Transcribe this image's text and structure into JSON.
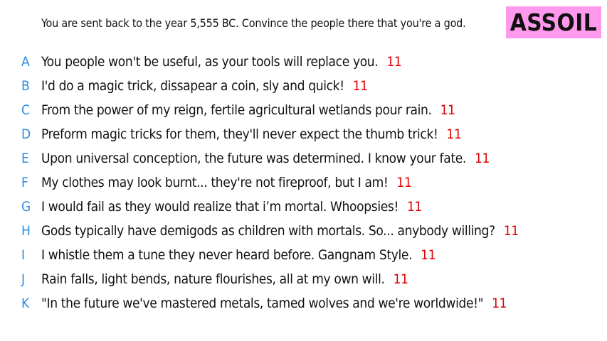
{
  "prompt": "You are sent back to the year 5,555 BC. Convince the people there that you're a god.",
  "player": {
    "name": "ASSOIL",
    "badge_color": "#ff99ee"
  },
  "colors": {
    "letter": "#2d8ce0",
    "score": "#e00000",
    "text": "#111111"
  },
  "answers": [
    {
      "letter": "A",
      "text": "You people won't be useful, as your tools will replace you.",
      "score": "11"
    },
    {
      "letter": "B",
      "text": "I'd do a magic trick, dissapear a coin, sly and quick!",
      "score": "11"
    },
    {
      "letter": "C",
      "text": "From the power of my reign, fertile agricultural wetlands pour rain.",
      "score": "11"
    },
    {
      "letter": "D",
      "text": "Preform magic tricks for them, they'll never expect the thumb trick!",
      "score": "11"
    },
    {
      "letter": "E",
      "text": "Upon universal conception, the future was determined. I know your fate.",
      "score": "11"
    },
    {
      "letter": "F",
      "text": "My clothes may look burnt... they're not fireproof, but I am!",
      "score": "11"
    },
    {
      "letter": "G",
      "text": "I would fail as they would realize that i’m mortal. Whoopsies!",
      "score": "11"
    },
    {
      "letter": "H",
      "text": "Gods typically have demigods as children with mortals. So... anybody willing?",
      "score": "11"
    },
    {
      "letter": "I",
      "text": "I whistle them a tune they never heard before. Gangnam Style.",
      "score": "11"
    },
    {
      "letter": "J",
      "text": "Rain falls, light bends, nature flourishes, all at my own will.",
      "score": "11"
    },
    {
      "letter": "K",
      "text": "\"In the future we've mastered metals, tamed wolves and we're worldwide!\"",
      "score": "11"
    }
  ]
}
